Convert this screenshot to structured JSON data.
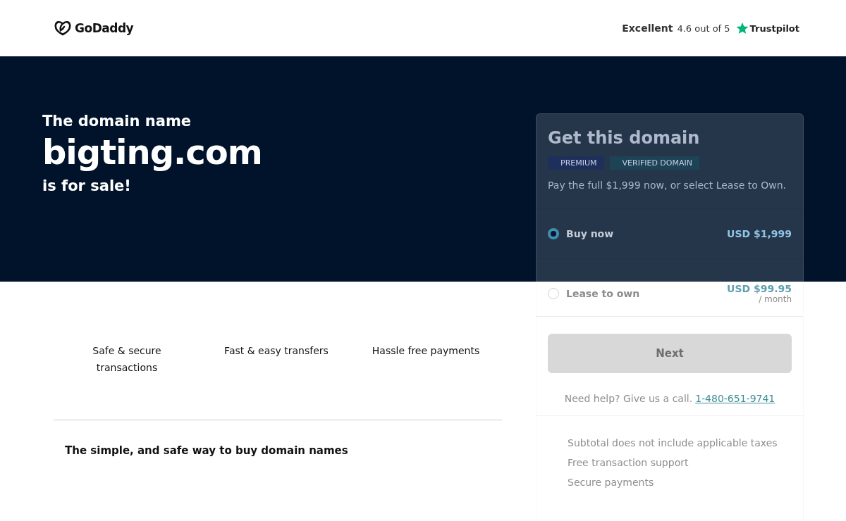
{
  "header": {
    "logo": "GoDaddy",
    "rating_word": "Excellent",
    "rating_score": "4.6 out of 5",
    "review_site": "Trustpilot"
  },
  "hero": {
    "intro": "The domain name",
    "domain": "bigting.com",
    "outro": "is for sale!"
  },
  "features": [
    "Safe & secure transactions",
    "Fast & easy transfers",
    "Hassle free payments"
  ],
  "section_heading": "The simple, and safe way to buy domain names",
  "card": {
    "title": "Get this domain",
    "tags": [
      {
        "label": "PREMIUM",
        "color": "#1e2f5c"
      },
      {
        "label": "VERIFIED DOMAIN",
        "color": "#1d4356"
      }
    ],
    "description": "Pay the full $1,999 now, or select Lease to Own.",
    "options": [
      {
        "label": "Buy now",
        "price": "USD $1,999",
        "selected": true
      },
      {
        "label": "Lease to own",
        "price": "USD $99.95",
        "period": "/ month",
        "selected": false
      }
    ],
    "button": {
      "label": "Next",
      "disabled": true
    },
    "help_text": "Need help? Give us a call.",
    "phone": "1-480-651-9741",
    "notes": [
      "Subtotal does not include applicable taxes",
      "Free transaction support",
      "Secure payments"
    ]
  }
}
